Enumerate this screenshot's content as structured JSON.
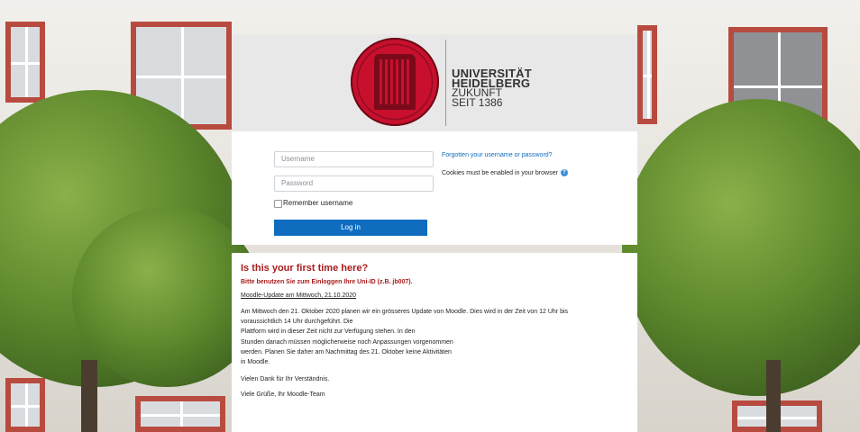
{
  "logo": {
    "line1": "UNIVERSITÄT",
    "line2": "HEIDELBERG",
    "line3": "ZUKUNFT",
    "line4": "SEIT 1386"
  },
  "login": {
    "username_placeholder": "Username",
    "password_placeholder": "Password",
    "remember_label": "Remember username",
    "login_button": "Log in",
    "forgot_link": "Forgotten your username or password?",
    "cookies_text": "Cookies must be enabled in your browser"
  },
  "info": {
    "heading": "Is this your first time here?",
    "notice": "Bitte benutzen Sie zum Einloggen Ihre Uni-ID (z.B. jb007).",
    "update_title": "Moodle-Update am Mittwoch, 21.10.2020",
    "paragraph_lines": [
      "Am  Mittwoch den 21. Oktober 2020 planen wir ein grösseres Update von Moodle. Dies wird in der Zeit von 12 Uhr bis",
      "voraussichtlich 14 Uhr durchgeführt. Die",
      "Plattform wird in dieser Zeit nicht zur Verfügung stehen. In den",
      "Stunden danach müssen möglicherweise noch Anpassungen vorgenommen",
      "werden. Planen Sie daher am Nachmittag des 21. Oktober keine Aktivitäten",
      "in Moodle."
    ],
    "thanks": "Vielen Dank für Ihr Verständnis.",
    "greeting": " Viele Grüße, Ihr Moodle-Team"
  },
  "colors": {
    "brand_red": "#c8102e",
    "button_blue": "#0f6cbf",
    "heading_red": "#a81c1c"
  }
}
